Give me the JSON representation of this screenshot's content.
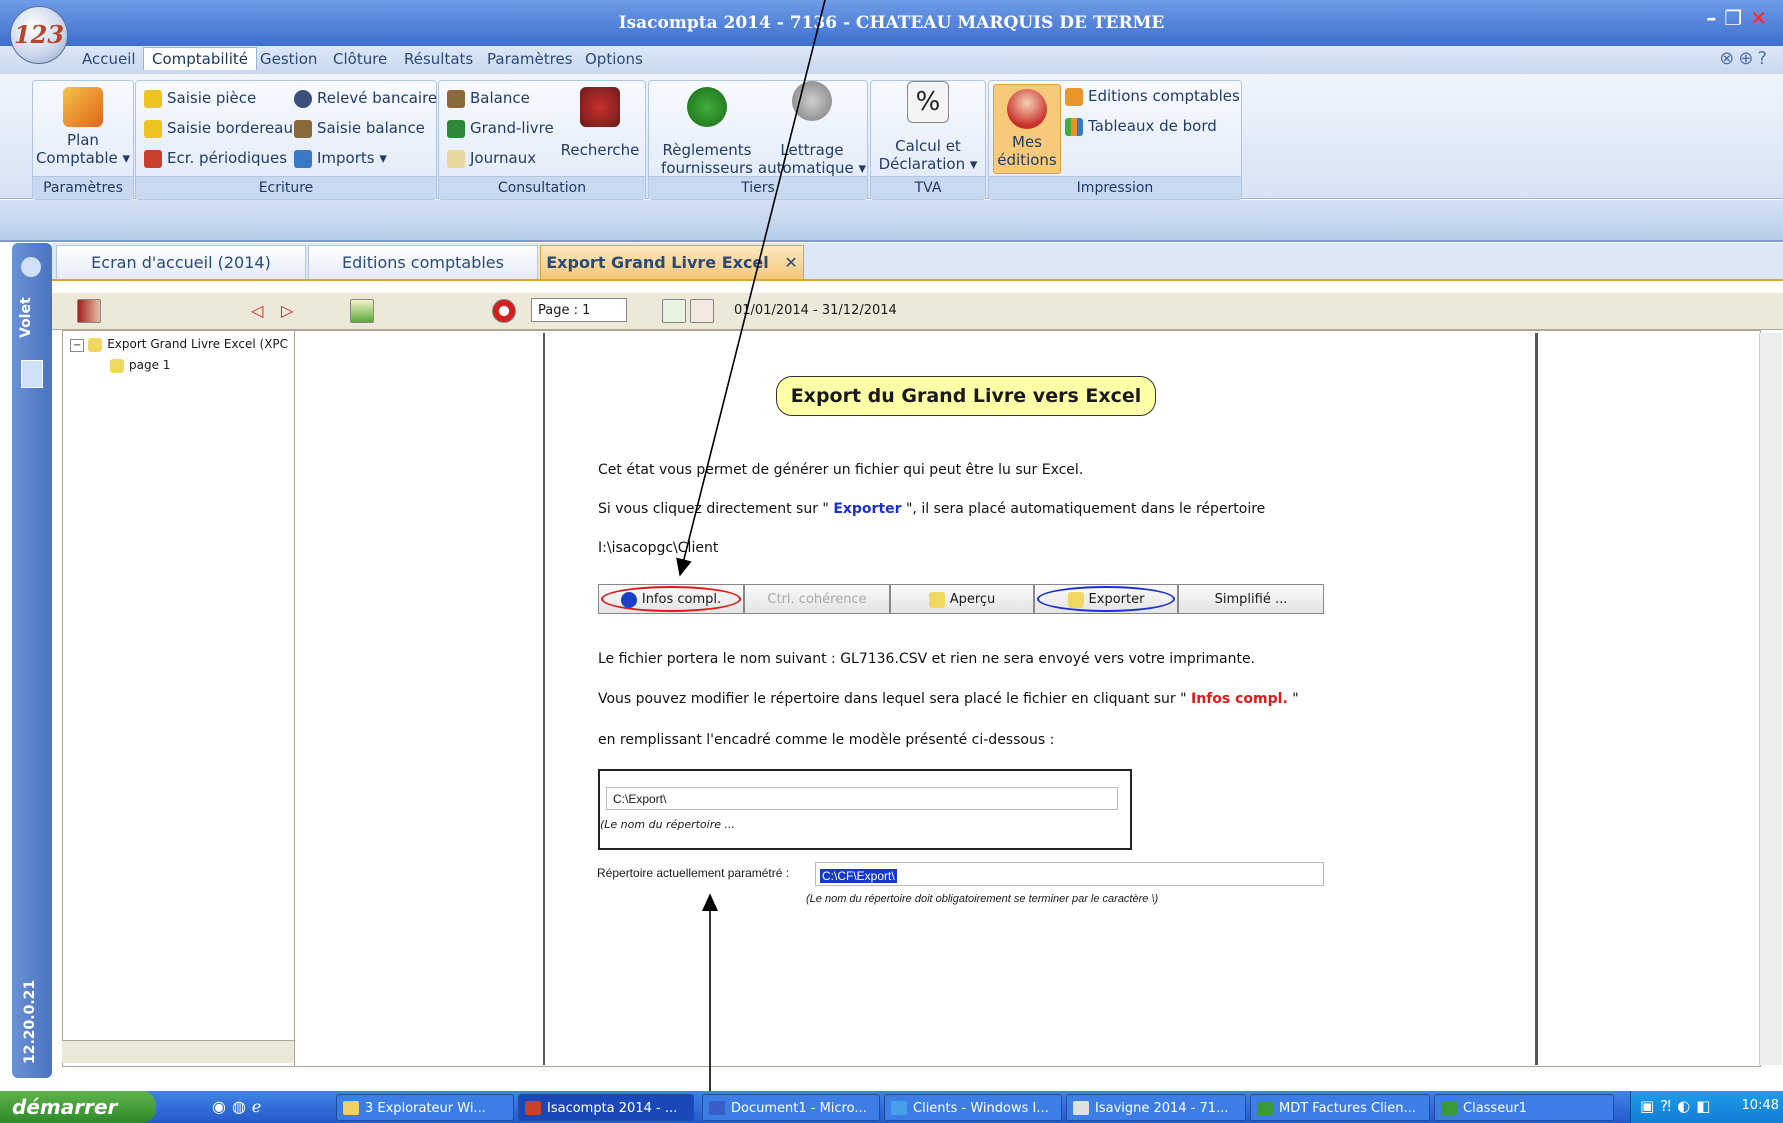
{
  "window": {
    "title": "Isacompta 2014 - 7136 - CHATEAU MARQUIS DE TERME",
    "logo": "123"
  },
  "menu": [
    "Accueil",
    "Comptabilité",
    "Gestion",
    "Clôture",
    "Résultats",
    "Paramètres",
    "Options"
  ],
  "ribbon": {
    "parametres": {
      "label": "Paramètres",
      "plan_line1": "Plan",
      "plan_line2": "Comptable ▾"
    },
    "ecriture": {
      "label": "Ecriture",
      "items": [
        "Saisie pièce",
        "Relevé bancaire",
        "Saisie bordereau",
        "Saisie balance",
        "Ecr. périodiques",
        "Imports ▾"
      ]
    },
    "consultation": {
      "label": "Consultation",
      "items": [
        "Balance",
        "Grand-livre",
        "Journaux"
      ],
      "recherche": "Recherche"
    },
    "tiers": {
      "label": "Tiers",
      "reglements_line1": "Règlements",
      "reglements_line2": "fournisseurs",
      "lettrage_line1": "Lettrage",
      "lettrage_line2": "automatique ▾"
    },
    "tva": {
      "label": "TVA",
      "calcul_line1": "Calcul et",
      "calcul_line2": "Déclaration ▾"
    },
    "impression": {
      "label": "Impression",
      "mes_line1": "Mes",
      "mes_line2": "éditions",
      "items": [
        "Editions comptables",
        "Tableaux de bord"
      ]
    }
  },
  "volet": {
    "label": "Volet",
    "version": "12.20.0.21"
  },
  "tabs": [
    {
      "label": "Ecran d'accueil  (2014)"
    },
    {
      "label": "Editions comptables"
    },
    {
      "label": "Export Grand Livre Excel",
      "close": "✕"
    }
  ],
  "toolbar": {
    "page": "Page : 1",
    "date_range": "01/01/2014 - 31/12/2014"
  },
  "tree": {
    "root": "Export Grand Livre Excel (XPC",
    "child": "page 1"
  },
  "document": {
    "title": "Export du Grand Livre vers Excel",
    "line1": "Cet état vous permet de générer un fichier qui peut être lu sur Excel.",
    "line2_a": "Si vous cliquez directement sur \" ",
    "line2_b": "Exporter",
    "line2_c": " \", il sera placé automatiquement dans le répertoire",
    "line3": "I:\\isacopgc\\Client",
    "buttons": [
      "Infos compl.",
      "Ctrl. cohérence",
      "Aperçu",
      "Exporter",
      "Simplifié ..."
    ],
    "line4": "Le fichier portera le nom suivant : GL7136.CSV et rien ne sera envoyé vers votre imprimante.",
    "line5_a": "Vous pouvez modifier le répertoire dans lequel sera placé le fichier en cliquant sur \" ",
    "line5_b": "Infos compl.",
    "line5_c": " \"",
    "line6": "en remplissant l'encadré comme le modèle présenté ci-dessous :",
    "model_value": "C:\\Export\\",
    "model_hint": "(Le nom du répertoire ...",
    "current_label": "Répertoire actuellement paramétré :",
    "current_value": "C:\\CF\\Export\\",
    "note": "(Le nom du répertoire doit obligatoirement se terminer par le caractère \\)"
  },
  "taskbar": {
    "start": "démarrer",
    "tasks": [
      "3 Explorateur Wi...",
      "Isacompta 2014 - ...",
      "Document1 - Micro...",
      "Clients - Windows I...",
      "Isavigne 2014 - 71...",
      "MDT Factures Clien...",
      "Classeur1"
    ],
    "clock": "10:48"
  },
  "colors": {
    "title_bar": "#3d6fcf",
    "active_tab": "#f4c879",
    "doc_title_bg": "#ffffa8",
    "exporter_text": "#1c2fd1",
    "infos_text": "#e01818"
  }
}
